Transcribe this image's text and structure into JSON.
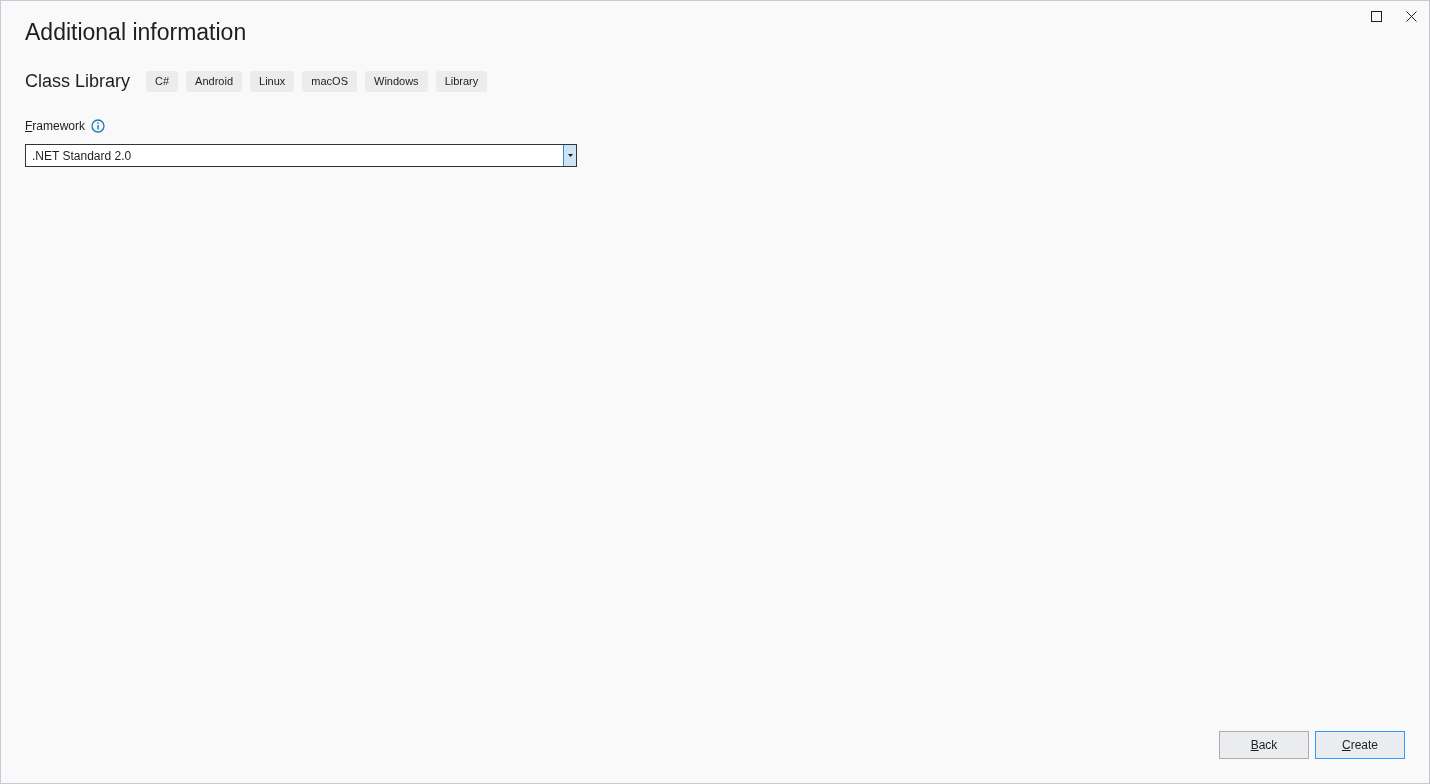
{
  "window": {
    "title": "Additional information"
  },
  "template": {
    "name": "Class Library",
    "tags": [
      "C#",
      "Android",
      "Linux",
      "macOS",
      "Windows",
      "Library"
    ]
  },
  "framework": {
    "label": "Framework",
    "mnemonic": true,
    "value": ".NET Standard 2.0"
  },
  "buttons": [
    {
      "label": "Back",
      "mnemonic": true,
      "focused": false
    },
    {
      "label": "Create",
      "mnemonic": true,
      "focused": true
    }
  ]
}
